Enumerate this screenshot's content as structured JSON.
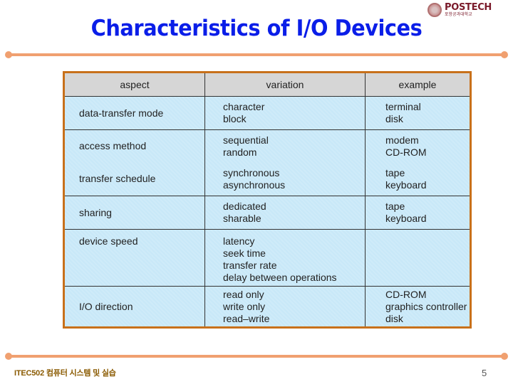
{
  "logo": {
    "name": "POSTECH",
    "subtitle": "포항공과대학교",
    "icon": "university-seal-icon"
  },
  "title": "Characteristics of I/O Devices",
  "table": {
    "headers": [
      "aspect",
      "variation",
      "example"
    ],
    "rows": [
      {
        "aspect": "data-transfer mode",
        "variation": [
          "character",
          "block"
        ],
        "example": [
          "terminal",
          "disk"
        ]
      },
      {
        "aspect": "access method",
        "variation": [
          "sequential",
          "random"
        ],
        "example": [
          "modem",
          "CD-ROM"
        ]
      },
      {
        "aspect": "transfer schedule",
        "variation": [
          "synchronous",
          "asynchronous"
        ],
        "example": [
          "tape",
          "keyboard"
        ]
      },
      {
        "aspect": "sharing",
        "variation": [
          "dedicated",
          "sharable"
        ],
        "example": [
          "tape",
          "keyboard"
        ]
      },
      {
        "aspect": "device speed",
        "variation": [
          "latency",
          "seek time",
          "transfer rate",
          "delay between operations"
        ],
        "example": []
      },
      {
        "aspect": "I/O direction",
        "variation": [
          "read only",
          "write only",
          "read–write"
        ],
        "example": [
          "CD-ROM",
          "graphics controller",
          "disk"
        ]
      }
    ]
  },
  "footer": {
    "course": "ITEC502 컴퓨터 시스템 및 실습",
    "page": "5"
  },
  "colors": {
    "title": "#0a1ee8",
    "rule": "#f0a070",
    "table_border": "#c8701a",
    "cell_bg": "#c8e8f8",
    "header_bg": "#d6d6d6",
    "footer_text": "#8a5a00"
  }
}
